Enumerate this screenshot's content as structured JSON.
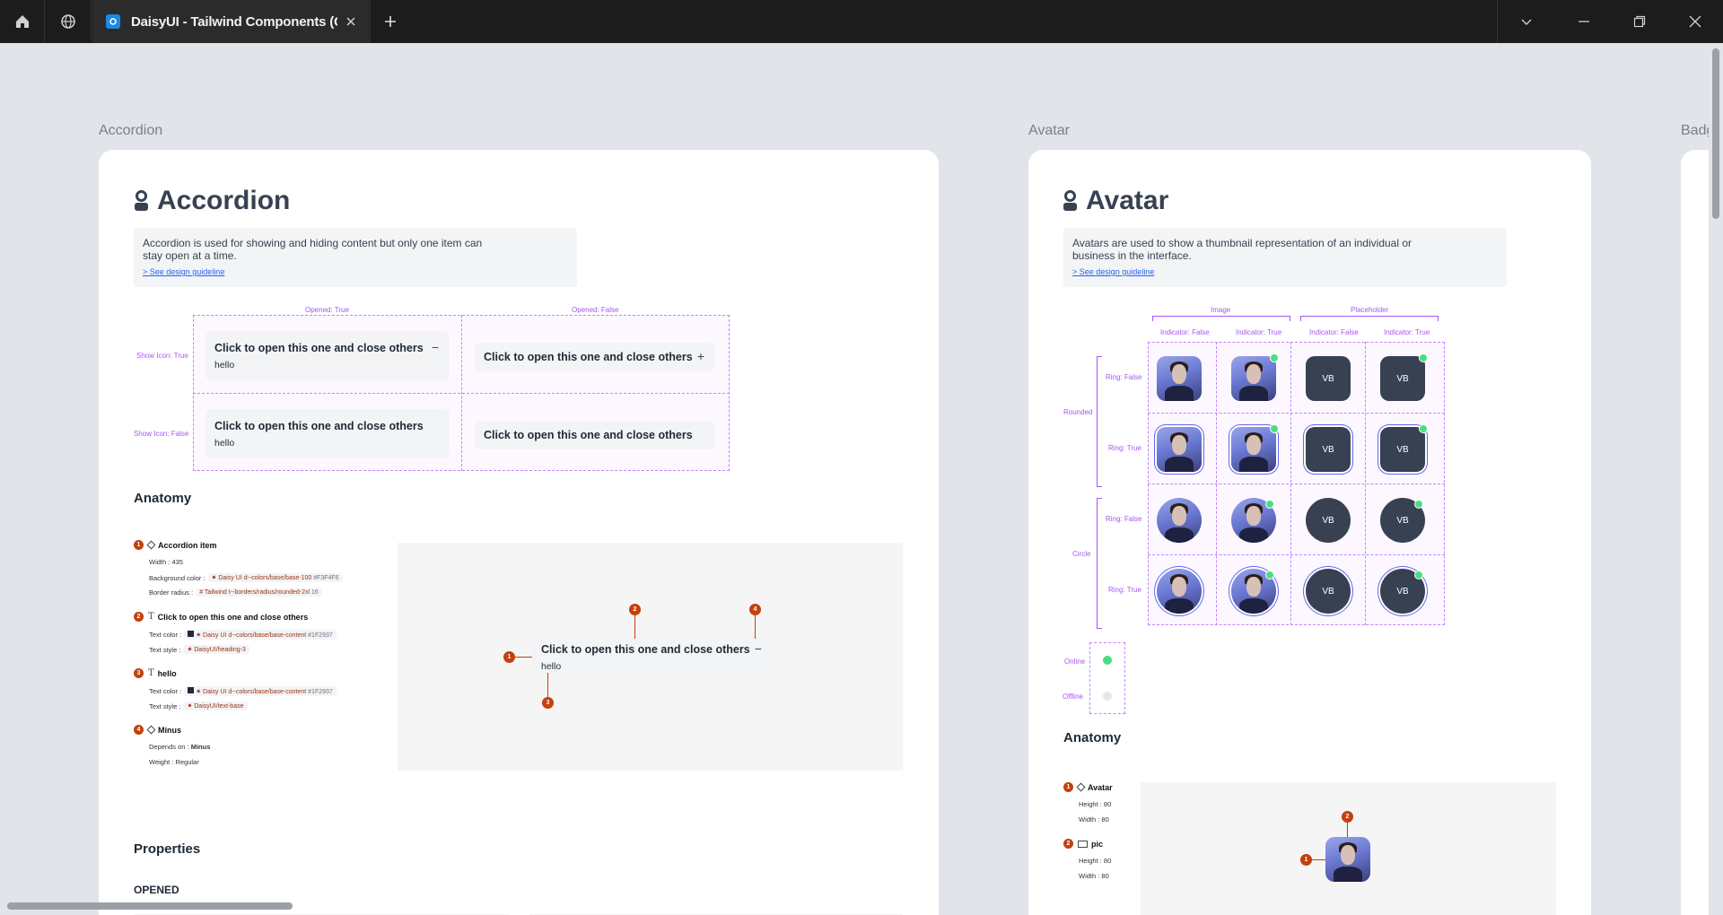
{
  "browser": {
    "tab_title": "DaisyUI - Tailwind Components (C",
    "icons": [
      "home-icon",
      "globe-icon",
      "favicon-icon",
      "close-icon",
      "plus-icon",
      "chevron-down-icon",
      "minimize-icon",
      "maximize-icon",
      "window-close-icon"
    ]
  },
  "frames": {
    "accordion_label": "Accordion",
    "avatar_label": "Avatar",
    "badge_label": "Badge"
  },
  "accordion": {
    "title": "Accordion",
    "description": "Accordion is used for showing and hiding content but only one item can stay open at a time.",
    "guideline_link": "> See design guideline",
    "col_opened_true": "Opened: True",
    "col_opened_false": "Opened: False",
    "row_show_icon_true": "Show Icon: True",
    "row_show_icon_false": "Show Icon: False",
    "item_title": "Click to open this one and close others",
    "item_body": "hello",
    "minus": "−",
    "plus": "+",
    "anatomy_heading": "Anatomy",
    "properties_heading": "Properties",
    "opened_heading": "OPENED",
    "anatomy": {
      "a1_name": "Accordion item",
      "a1_width": "Width : 435",
      "a1_bg_label": "Background color :",
      "a1_bg_chip": "Daisy UI d--colors/base/base-100",
      "a1_bg_hex": "#F3F4F6",
      "a1_radius_label": "Border radius :",
      "a1_radius_chip": "Tailwind t--borders/radius/rounded-2xl",
      "a1_radius_val": "16",
      "a2_name": "Click to open this one and close others",
      "a2_color_label": "Text color :",
      "a2_color_chip": "Daisy UI d--colors/base/base-content",
      "a2_color_hex": "#1F2937",
      "a2_style_label": "Text style :",
      "a2_style_chip": "DaisyUI/heading-3",
      "a3_name": "hello",
      "a3_color_label": "Text color :",
      "a3_color_chip": "Daisy UI d--colors/base/base-content",
      "a3_color_hex": "#1F2937",
      "a3_style_label": "Text style :",
      "a3_style_chip": "DaisyUI/text-base",
      "a4_name": "Minus",
      "a4_dep_label": "Depends on :",
      "a4_dep_val": "Minus",
      "a4_weight": "Weight : Regular",
      "n1": "1",
      "n2": "2",
      "n3": "3",
      "n4": "4"
    }
  },
  "avatar": {
    "title": "Avatar",
    "description": "Avatars are used to show a thumbnail representation of an individual or business in the interface.",
    "guideline_link": "> See design guideline",
    "group_image": "Image",
    "group_placeholder": "Placeholder",
    "ind_false": "Indicator: False",
    "ind_true": "Indicator: True",
    "rounded": "Rounded",
    "circle": "Circle",
    "ring_false": "Ring: False",
    "ring_true": "Ring: True",
    "placeholder_text": "VB",
    "online": "Online",
    "offline": "Offline",
    "anatomy_heading": "Anatomy",
    "anatomy": {
      "a1_name": "Avatar",
      "a1_height": "Height : 80",
      "a1_width": "Width : 80",
      "a2_name": "pic",
      "a2_height": "Height : 80",
      "a2_width": "Width : 80",
      "n1": "1",
      "n2": "2"
    }
  },
  "colors": {
    "accent_purple": "#a855f7",
    "marker_orange": "#c2410c",
    "online_green": "#4ade80",
    "placeholder_bg": "#374151"
  }
}
